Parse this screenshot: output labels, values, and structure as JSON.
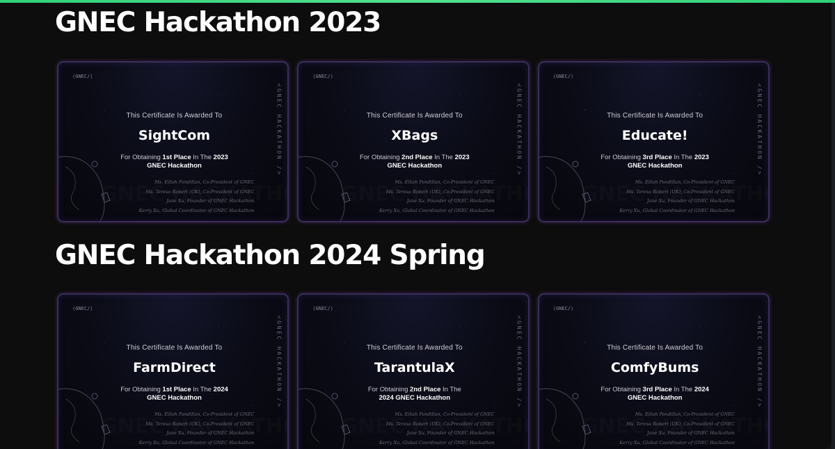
{
  "sections": [
    {
      "title": "GNEC Hackathon 2023",
      "certificates": [
        {
          "awarded": "This Certificate Is Awarded To",
          "team": "SightCom",
          "for_prefix": "For Obtaining ",
          "place": "1st Place",
          "for_mid": " In The ",
          "year": "2023",
          "event": "GNEC Hackathon"
        },
        {
          "awarded": "This Certificate Is Awarded To",
          "team": "XBags",
          "for_prefix": "For Obtaining ",
          "place": "2nd Place",
          "for_mid": " In The ",
          "year": "2023",
          "event": "GNEC Hackathon"
        },
        {
          "awarded": "This Certificate Is Awarded To",
          "team": "Educate!",
          "for_prefix": "For Obtaining ",
          "place": "3rd Place",
          "for_mid": " In The ",
          "year": "2023",
          "event": "GNEC Hackathon"
        }
      ]
    },
    {
      "title": "GNEC Hackathon 2024 Spring",
      "certificates": [
        {
          "awarded": "This Certificate Is Awarded To",
          "team": "FarmDirect",
          "for_prefix": "For Obtaining ",
          "place": "1st Place",
          "for_mid": " In The ",
          "year": "2024",
          "event": "GNEC Hackathon"
        },
        {
          "awarded": "This Certificate Is Awarded To",
          "team": "TarantulaX",
          "for_prefix": "For Obtaining ",
          "place": "2nd Place",
          "for_mid": " In The ",
          "year": "",
          "event": "2024 GNEC Hackathon"
        },
        {
          "awarded": "This Certificate Is Awarded To",
          "team": "ComfyBums",
          "for_prefix": "For Obtaining ",
          "place": "3rd Place",
          "for_mid": " In The ",
          "year": "2024",
          "event": "GNEC Hackathon"
        }
      ]
    }
  ],
  "certificate_common": {
    "logo": "⟨GNEC/⟩",
    "side_text": "<GNEC HACKATHON />",
    "signatures": [
      "Ms. Eilish Pandillan, Co-President of GNEC",
      "Ms. Teresa Robert (UK), Co-President of GNEC",
      "Jane Xu, Founder of GNEC Hackathon",
      "Kerry Xu, Global Coordinator of GNEC Hackathon"
    ],
    "watermark": "GNEC HACKATHON"
  },
  "colors": {
    "accent_top": "#2fd07a",
    "card_border": "#3a2d5a",
    "page_bg": "#0d0d0d"
  }
}
